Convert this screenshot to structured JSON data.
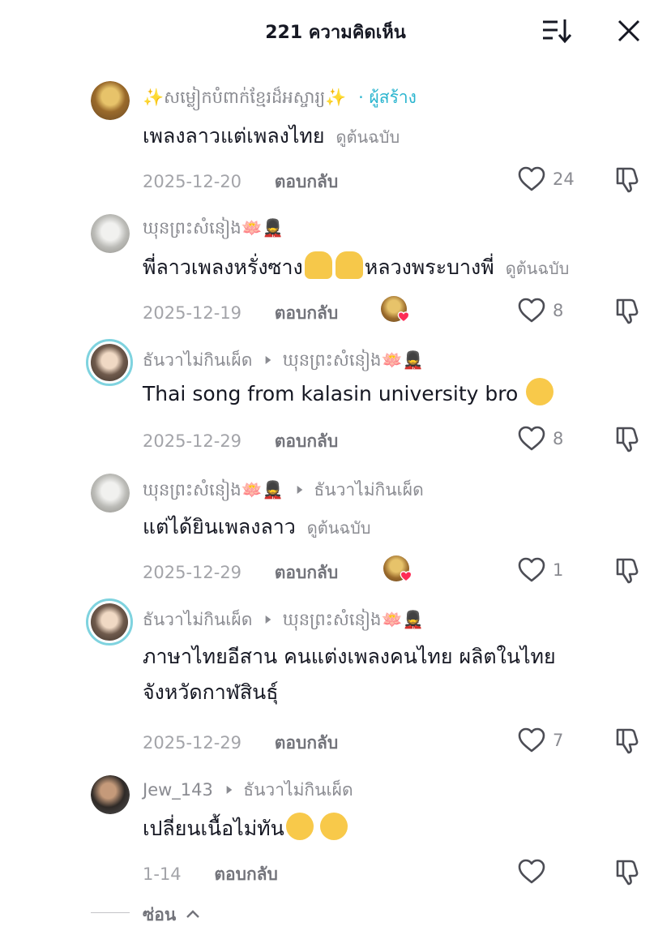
{
  "header": {
    "title": "221 ความคิดเห็น"
  },
  "comments": [
    {
      "username": "✨សម្លៀកបំពាក់ខ្មែរដ៏អស្ចារ្យ✨",
      "badge": "· ผู้สร้าง",
      "text": "เพลงลาวแต่เพลงไทย",
      "translate": "ดูต้นฉบับ",
      "date": "2025-12-20",
      "reply": "ตอบกลับ",
      "likes": "24"
    },
    {
      "username": "ឃុនព្រះសំនៀង🪷💂",
      "text_a": "พี่ลาวเพลงหรั่งซาง",
      "text_b": "หลวงพระบางพี่",
      "translate": "ดูต้นฉบับ",
      "date": "2025-12-19",
      "reply": "ตอบกลับ",
      "likes": "8"
    },
    {
      "username": "ธันวาไม่กินเผ็ด",
      "reply_to": "ឃុនព្រះសំនៀង🪷💂",
      "text": "Thai song from kalasin university bro",
      "date": "2025-12-29",
      "reply": "ตอบกลับ",
      "likes": "8"
    },
    {
      "username": "ឃុនព្រះសំនៀង🪷💂",
      "reply_to": "ธันวาไม่กินเผ็ด",
      "text": "แต่ได้ยินเพลงลาว",
      "translate": "ดูต้นฉบับ",
      "date": "2025-12-29",
      "reply": "ตอบกลับ",
      "likes": "1"
    },
    {
      "username": "ธันวาไม่กินเผ็ด",
      "reply_to": "ឃុនព្រះសំនៀង🪷💂",
      "text_line1": "ภาษาไทยอีสาน คนแต่งเพลงคนไทย ผลิตในไทย",
      "text_line2": "จังหวัดกาฬสินธุ์",
      "date": "2025-12-29",
      "reply": "ตอบกลับ",
      "likes": "7"
    },
    {
      "username": "Jew_143",
      "reply_to": "ธันวาไม่กินเผ็ด",
      "text": "เปลี่ยนเนื้อไม่ทัน",
      "date": "1-14",
      "reply": "ตอบกลับ",
      "likes": ""
    }
  ],
  "footer": {
    "hide_label": "ซ่อน"
  },
  "icons": {
    "sort": "sort-icon",
    "close": "close-icon",
    "like": "heart-outline-icon",
    "dislike": "thumbs-down-icon",
    "caret": "caret-right-icon",
    "chevron": "chevron-up-icon"
  },
  "colors": {
    "creator_badge": "#2bb5cf",
    "liked_heart": "#fe2c55",
    "avatar_ring": "#7fd3df"
  }
}
